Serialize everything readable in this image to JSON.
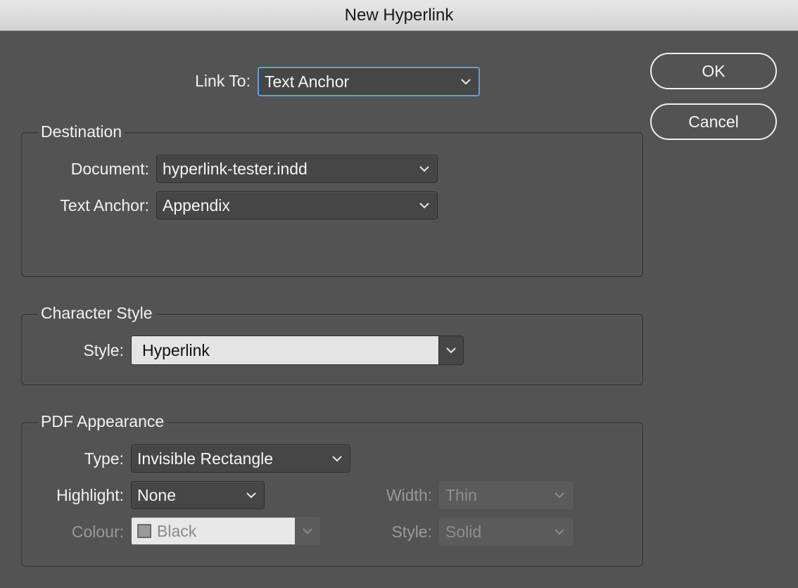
{
  "window": {
    "title": "New Hyperlink"
  },
  "link_to": {
    "label": "Link To:",
    "value": "Text Anchor"
  },
  "destination": {
    "title": "Destination",
    "document_label": "Document:",
    "document_value": "hyperlink-tester.indd",
    "anchor_label": "Text Anchor:",
    "anchor_value": "Appendix"
  },
  "character_style": {
    "title": "Character Style",
    "style_label": "Style:",
    "style_value": "Hyperlink"
  },
  "pdf_appearance": {
    "title": "PDF Appearance",
    "type_label": "Type:",
    "type_value": "Invisible Rectangle",
    "highlight_label": "Highlight:",
    "highlight_value": "None",
    "colour_label": "Colour:",
    "colour_value": "Black",
    "width_label": "Width:",
    "width_value": "Thin",
    "style_label": "Style:",
    "style_value": "Solid"
  },
  "buttons": {
    "ok": "OK",
    "cancel": "Cancel"
  },
  "colors": {
    "dialog_bg": "#535353",
    "focus_ring": "#5aa0e6",
    "titlebar": "#dcdcdc"
  }
}
